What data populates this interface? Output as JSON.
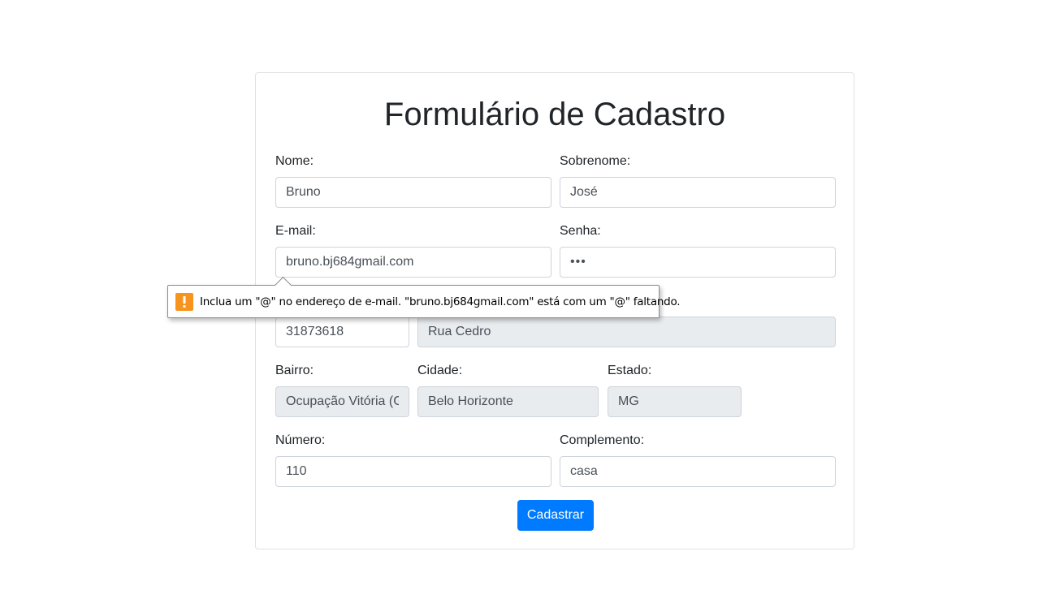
{
  "form": {
    "title": "Formulário de Cadastro",
    "nome": {
      "label": "Nome:",
      "value": "Bruno"
    },
    "sobrenome": {
      "label": "Sobrenome:",
      "value": "José"
    },
    "email": {
      "label": "E-mail:",
      "value": "bruno.bj684gmail.com"
    },
    "senha": {
      "label": "Senha:",
      "value": "•••"
    },
    "cep": {
      "value": "31873618"
    },
    "rua": {
      "value": "Rua Cedro"
    },
    "bairro": {
      "label": "Bairro:",
      "value": "Ocupação Vitória (G"
    },
    "cidade": {
      "label": "Cidade:",
      "value": "Belo Horizonte"
    },
    "estado": {
      "label": "Estado:",
      "value": "MG"
    },
    "numero": {
      "label": "Número:",
      "value": "110"
    },
    "complemento": {
      "label": "Complemento:",
      "value": "casa"
    },
    "submit_label": "Cadastrar"
  },
  "validation_tooltip": {
    "icon": "warning-icon",
    "icon_color": "#f7941d",
    "message": "Inclua um \"@\" no endereço de e-mail. \"bruno.bj684gmail.com\" está com um \"@\" faltando."
  },
  "colors": {
    "primary": "#007bff",
    "readonly_bg": "#e9ecef",
    "border": "#ced4da"
  }
}
